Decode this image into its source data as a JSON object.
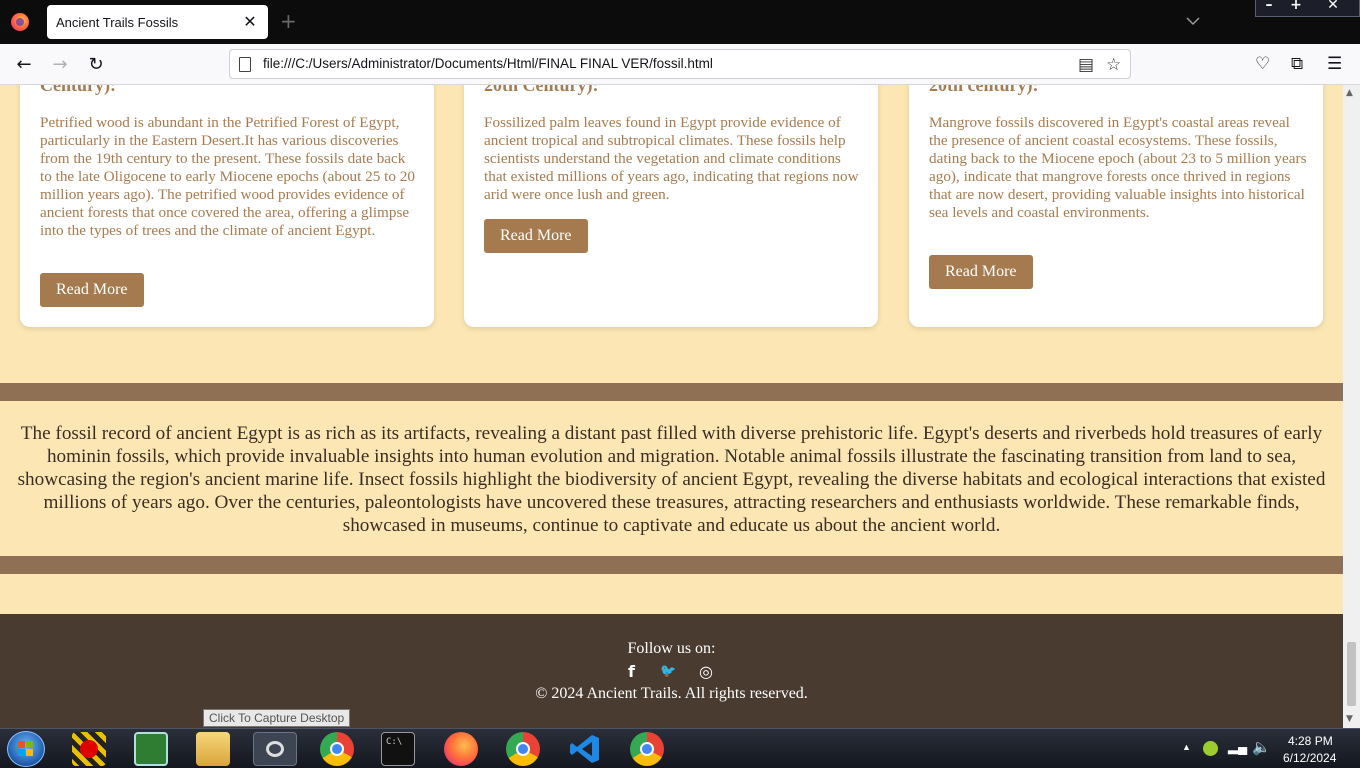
{
  "browser": {
    "tab_title": "Ancient Trails Fossils",
    "tab_close": "✕",
    "new_tab": "+",
    "url": "file:///C:/Users/Administrator/Documents/Html/FINAL FINAL VER/fossil.html"
  },
  "cards": [
    {
      "title": "Century):",
      "text": "Petrified wood is abundant in the Petrified Forest of Egypt, particularly in the Eastern Desert.It has various discoveries from the 19th century to the present. These fossils date back to the late Oligocene to early Miocene epochs (about 25 to 20 million years ago). The petrified wood provides evidence of ancient forests that once covered the area, offering a glimpse into the types of trees and the climate of ancient Egypt.",
      "button": "Read More"
    },
    {
      "title": "20th Century):",
      "text": "Fossilized palm leaves found in Egypt provide evidence of ancient tropical and subtropical climates. These fossils help scientists understand the vegetation and climate conditions that existed millions of years ago, indicating that regions now arid were once lush and green.",
      "button": "Read More"
    },
    {
      "title": "20th century):",
      "text": "Mangrove fossils discovered in Egypt's coastal areas reveal the presence of ancient coastal ecosystems. These fossils, dating back to the Miocene epoch (about 23 to 5 million years ago), indicate that mangrove forests once thrived in regions that are now desert, providing valuable insights into historical sea levels and coastal environments.",
      "button": "Read More"
    }
  ],
  "summary": "The fossil record of ancient Egypt is as rich as its artifacts, revealing a distant past filled with diverse prehistoric life. Egypt's deserts and riverbeds hold treasures of early hominin fossils, which provide invaluable insights into human evolution and migration. Notable animal fossils illustrate the fascinating transition from land to sea, showcasing the region's ancient marine life. Insect fossils highlight the biodiversity of ancient Egypt, revealing the diverse habitats and ecological interactions that existed millions of years ago. Over the centuries, paleontologists have uncovered these treasures, attracting researchers and enthusiasts worldwide. These remarkable finds, showcased in museums, continue to captivate and educate us about the ancient world.",
  "footer": {
    "follow": "Follow us on:",
    "socials": [
      "f",
      "🐦",
      "◎"
    ],
    "copyright": "© 2024 Ancient Trails. All rights reserved."
  },
  "tooltip": "Click To Capture Desktop",
  "taskbar": {
    "time": "4:28 PM",
    "date": "6/12/2024",
    "apps": [
      "cmd-icon",
      "chrome-icon",
      "firefox-icon",
      "vscode-icon"
    ]
  },
  "colors": {
    "page_bg": "#fce7b4",
    "accent": "#a57a4f",
    "band": "#8f7054",
    "footer_bg": "#4a3b30"
  }
}
